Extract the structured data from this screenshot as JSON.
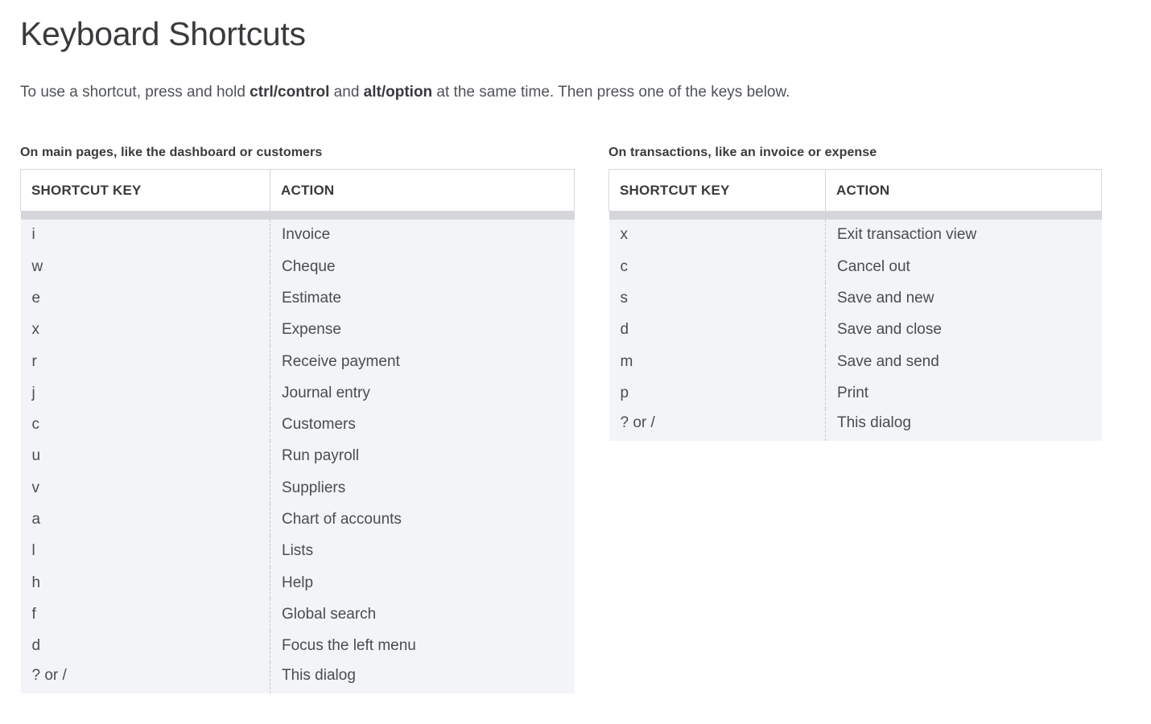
{
  "header": {
    "title": "Keyboard Shortcuts",
    "subtitle_parts": {
      "lead": "To use a shortcut, press and hold ",
      "key1": "ctrl/control",
      "middle": " and ",
      "key2": "alt/option",
      "tail": " at the same time. Then press one of the keys below."
    }
  },
  "tables": [
    {
      "section_label": "On main pages, like the dashboard or customers",
      "columns": [
        "SHORTCUT KEY",
        "ACTION"
      ],
      "rows": [
        {
          "key": "i",
          "action": "Invoice"
        },
        {
          "key": "w",
          "action": "Cheque"
        },
        {
          "key": "e",
          "action": "Estimate"
        },
        {
          "key": "x",
          "action": "Expense"
        },
        {
          "key": "r",
          "action": "Receive payment"
        },
        {
          "key": "j",
          "action": "Journal entry"
        },
        {
          "key": "c",
          "action": "Customers"
        },
        {
          "key": "u",
          "action": "Run payroll"
        },
        {
          "key": "v",
          "action": "Suppliers"
        },
        {
          "key": "a",
          "action": "Chart of accounts"
        },
        {
          "key": "l",
          "action": "Lists"
        },
        {
          "key": "h",
          "action": "Help"
        },
        {
          "key": "f",
          "action": "Global search"
        },
        {
          "key": "d",
          "action": "Focus the left menu"
        },
        {
          "key": "? or /",
          "action": "This dialog"
        }
      ]
    },
    {
      "section_label": "On transactions, like an invoice or expense",
      "columns": [
        "SHORTCUT KEY",
        "ACTION"
      ],
      "rows": [
        {
          "key": "x",
          "action": "Exit transaction view"
        },
        {
          "key": "c",
          "action": "Cancel out"
        },
        {
          "key": "s",
          "action": "Save and new"
        },
        {
          "key": "d",
          "action": "Save and close"
        },
        {
          "key": "m",
          "action": "Save and send"
        },
        {
          "key": "p",
          "action": "Print"
        },
        {
          "key": "? or /",
          "action": "This dialog"
        }
      ]
    }
  ],
  "colors": {
    "page_background": "#ffffff",
    "title_text": "#393a3d",
    "body_text": "#4a4c50",
    "table_body_background": "#f2f4f8",
    "table_border": "#d4d6da",
    "band": "#d4d6da",
    "dashed_divider": "#c3c6cc"
  }
}
